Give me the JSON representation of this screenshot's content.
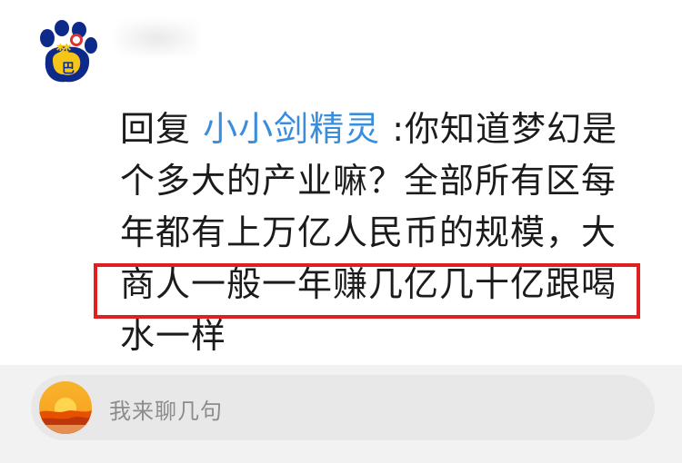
{
  "comment": {
    "reply_prefix": "回复",
    "mention": "小小剑精灵",
    "line1_rest": ":你知道梦幻是",
    "line2": "个多大的产业嘛？全部所有区每",
    "line3": "年都有上万亿人民币的规模，大",
    "line4": "商人一般一年赚几亿几十亿跟喝",
    "line5": "水一样"
  },
  "composer": {
    "placeholder": "我来聊几句"
  },
  "colors": {
    "mention": "#3a8ddb",
    "highlight": "#e02020",
    "text": "#1b1b1b",
    "placeholder": "#8c8c8c"
  },
  "icons": {
    "author_avatar": "paw-print-avatar-icon",
    "composer_avatar": "sunset-avatar-icon"
  }
}
